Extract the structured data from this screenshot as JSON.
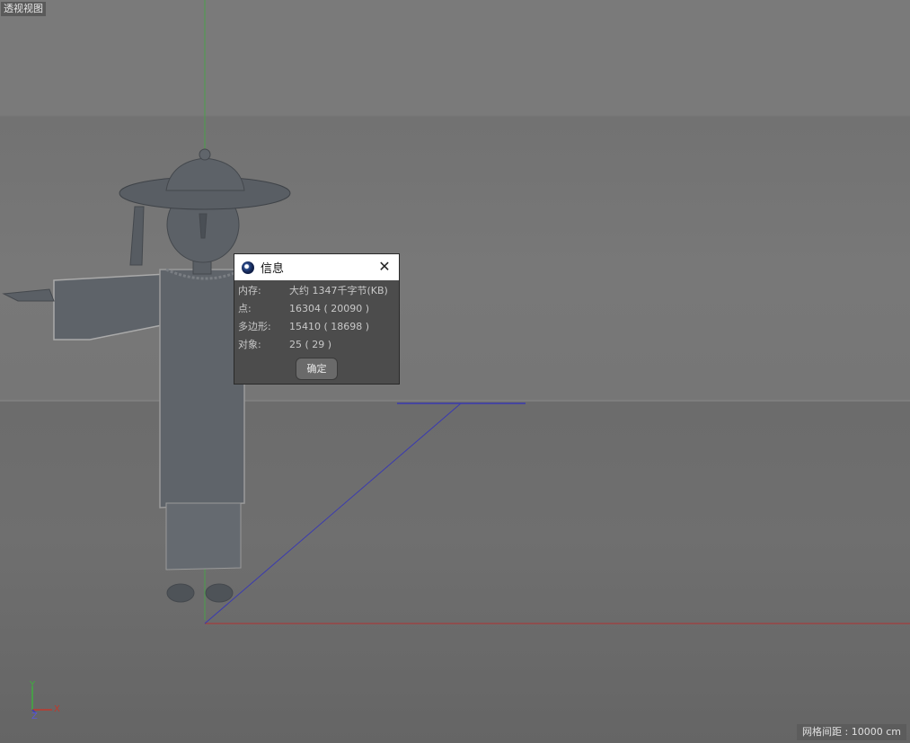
{
  "viewport": {
    "label": "透视视图",
    "grid_spacing": "网格间距 : 10000 cm",
    "axis_gizmo": {
      "y": "Y",
      "x": "X",
      "z": "Z"
    }
  },
  "dialog": {
    "title": "信息",
    "rows": [
      {
        "key": "内存:",
        "value": "大约 1347千字节(KB)"
      },
      {
        "key": "点:",
        "value": "16304 ( 20090 )"
      },
      {
        "key": "多边形:",
        "value": "15410 ( 18698 )"
      },
      {
        "key": "对象:",
        "value": "25 ( 29 )"
      }
    ],
    "ok_label": "确定"
  },
  "colors": {
    "axis_y": "#3fae3f",
    "axis_x": "#c0392b",
    "axis_z": "#3a3ab8"
  }
}
